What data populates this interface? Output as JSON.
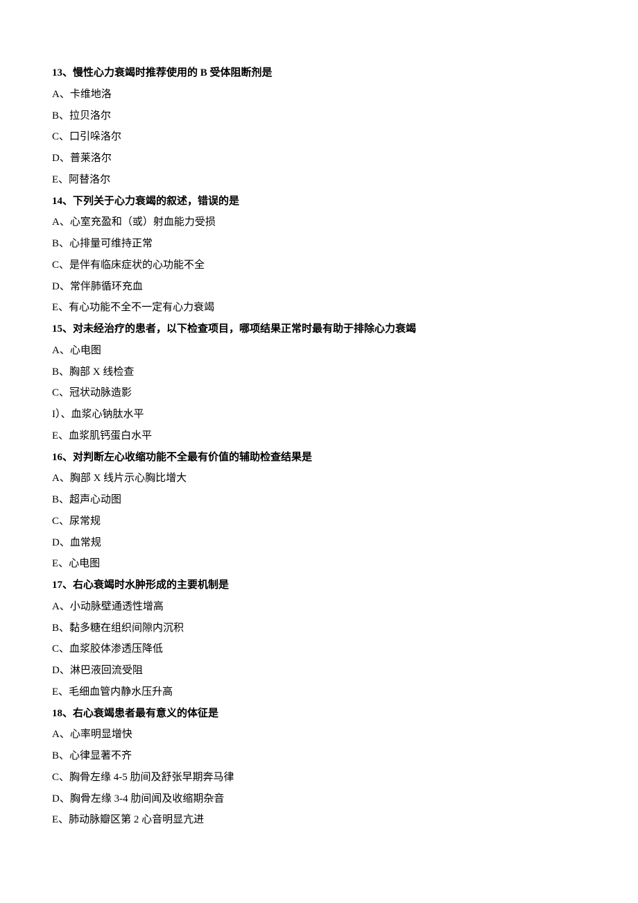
{
  "questions": [
    {
      "title": "13、慢性心力衰竭时推荐使用的 B 受体阻断剂是",
      "options": [
        "A、卡维地洛",
        "B、拉贝洛尔",
        "C、口引哚洛尔",
        "D、普莱洛尔",
        "E、阿替洛尔"
      ]
    },
    {
      "title": "14、下列关于心力衰竭的叙述，错误的是",
      "options": [
        "A、心室充盈和（或）射血能力受损",
        "B、心排量可维持正常",
        "C、是伴有临床症状的心功能不全",
        "D、常伴肺循环充血",
        "E、有心功能不全不一定有心力衰竭"
      ]
    },
    {
      "title": "15、对未经治疗的患者，以下检查项目，哪项结果正常时最有助于排除心力衰竭",
      "options": [
        "A、心电图",
        "B、胸部 X 线检查",
        "C、冠状动脉造影",
        "I）、血浆心钠肽水平",
        "E、血浆肌钙蛋白水平"
      ]
    },
    {
      "title": "16、对判断左心收缩功能不全最有价值的辅助检查结果是",
      "options": [
        "A、胸部 X 线片示心胸比增大",
        "B、超声心动图",
        "C、尿常规",
        "D、血常规",
        "E、心电图"
      ]
    },
    {
      "title": "17、右心衰竭时水肿形成的主要机制是",
      "options": [
        "A、小动脉壁通透性增高",
        "B、黏多糖在组织间隙内沉积",
        "C、血浆胶体渗透压降低",
        "D、淋巴液回流受阻",
        "E、毛细血管内静水压升高"
      ]
    },
    {
      "title": "18、右心衰竭患者最有意义的体征是",
      "options": [
        "A、心率明显增快",
        "B、心律显著不齐",
        "C、胸骨左缘 4-5 肋间及舒张早期奔马律",
        "D、胸骨左缘 3-4 肋间闻及收缩期杂音",
        "E、肺动脉瓣区第 2 心音明显亢进"
      ]
    }
  ]
}
